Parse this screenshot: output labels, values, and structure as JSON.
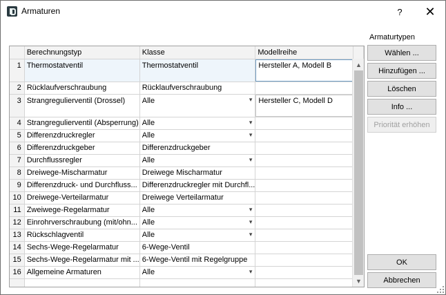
{
  "window": {
    "title": "Armaturen",
    "help_glyph": "?",
    "close_glyph": "✕"
  },
  "panel": {
    "section_label": "Armaturtypen",
    "buttons": {
      "waehlen": "Wählen ...",
      "hinzufuegen": "Hinzufügen ...",
      "loeschen": "Löschen",
      "info": "Info ...",
      "prioritaet": "Priorität erhöhen"
    },
    "ok": "OK",
    "abbrechen": "Abbrechen"
  },
  "grid": {
    "columns": [
      "Berechnungstyp",
      "Klasse",
      "Modellreihe"
    ],
    "rows": [
      {
        "num": "1",
        "typ": "Thermostatventil",
        "klasse": "Thermostatventil",
        "modell": "Hersteller A, Modell B",
        "combo": false
      },
      {
        "num": "2",
        "typ": "Rücklaufverschraubung",
        "klasse": "Rücklaufverschraubung",
        "modell": "",
        "combo": false
      },
      {
        "num": "3",
        "typ": "Strangregulierventil (Drossel)",
        "klasse": "Alle",
        "modell": "Hersteller C, Modell D",
        "combo": true
      },
      {
        "num": "4",
        "typ": "Strangregulierventil (Absperrung)",
        "klasse": "Alle",
        "modell": "",
        "combo": true
      },
      {
        "num": "5",
        "typ": "Differenzdruckregler",
        "klasse": "Alle",
        "modell": "",
        "combo": true
      },
      {
        "num": "6",
        "typ": "Differenzdruckgeber",
        "klasse": "Differenzdruckgeber",
        "modell": "",
        "combo": false
      },
      {
        "num": "7",
        "typ": "Durchflussregler",
        "klasse": "Alle",
        "modell": "",
        "combo": true
      },
      {
        "num": "8",
        "typ": "Dreiwege-Mischarmatur",
        "klasse": "Dreiwege Mischarmatur",
        "modell": "",
        "combo": false
      },
      {
        "num": "9",
        "typ": "Differenzdruck- und Durchfluss...",
        "klasse": "Differenzdruckregler mit Durchfl...",
        "modell": "",
        "combo": false
      },
      {
        "num": "10",
        "typ": "Dreiwege-Verteilarmatur",
        "klasse": "Dreiwege Verteilarmatur",
        "modell": "",
        "combo": false
      },
      {
        "num": "11",
        "typ": "Zweiwege-Regelarmatur",
        "klasse": "Alle",
        "modell": "",
        "combo": true
      },
      {
        "num": "12",
        "typ": "Einrohrverschraubung (mit/ohn...",
        "klasse": "Alle",
        "modell": "",
        "combo": true
      },
      {
        "num": "13",
        "typ": "Rückschlagventil",
        "klasse": "Alle",
        "modell": "",
        "combo": true
      },
      {
        "num": "14",
        "typ": "Sechs-Wege-Regelarmatur",
        "klasse": "6-Wege-Ventil",
        "modell": "",
        "combo": false
      },
      {
        "num": "15",
        "typ": "Sechs-Wege-Regelarmatur mit ...",
        "klasse": "6-Wege-Ventil mit Regelgruppe",
        "modell": "",
        "combo": false
      },
      {
        "num": "16",
        "typ": "Allgemeine Armaturen",
        "klasse": "Alle",
        "modell": "",
        "combo": true
      }
    ]
  }
}
